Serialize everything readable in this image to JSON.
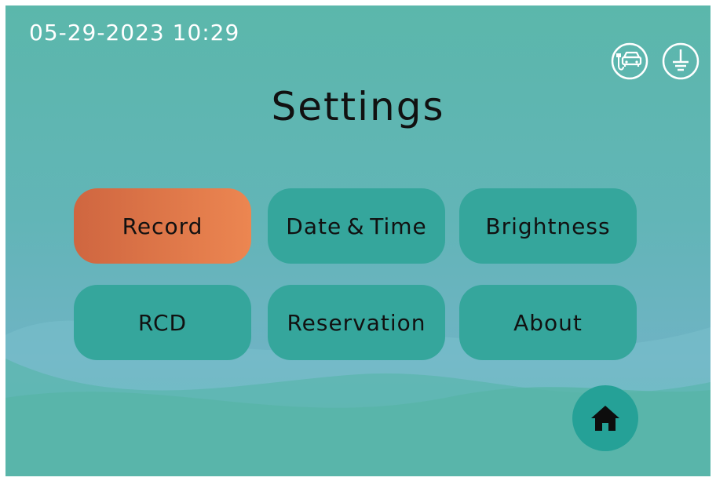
{
  "status_bar": {
    "datetime": "05-29-2023  10:29",
    "icons": [
      "ev-charger-car-icon",
      "ground-icon"
    ]
  },
  "page": {
    "title": "Settings"
  },
  "menu": [
    {
      "label": "Record",
      "active": true
    },
    {
      "label": "Date & Time",
      "active": false
    },
    {
      "label": "Brightness",
      "active": false
    },
    {
      "label": "RCD",
      "active": false
    },
    {
      "label": "Reservation",
      "active": false
    },
    {
      "label": "About",
      "active": false
    }
  ],
  "home_button": {
    "icon": "home-icon"
  },
  "colors": {
    "background_teal": "#5bb7ab",
    "button_teal": "#35a69c",
    "active_orange": "#e57d4c",
    "text": "#111111"
  }
}
